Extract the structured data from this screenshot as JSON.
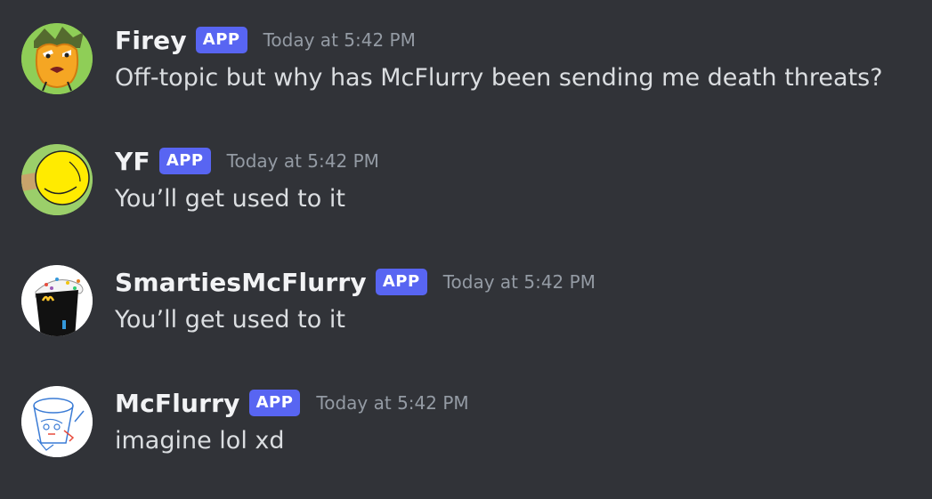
{
  "messages": [
    {
      "username": "Firey",
      "badge": "APP",
      "timestamp": "Today at 5:42 PM",
      "content": "Off-topic but why has McFlurry been sending me death threats?",
      "avatar_icon": "firey-avatar"
    },
    {
      "username": "YF",
      "badge": "APP",
      "timestamp": "Today at 5:42 PM",
      "content": "You’ll get used to it",
      "avatar_icon": "yf-avatar"
    },
    {
      "username": "SmartiesMcFlurry",
      "badge": "APP",
      "timestamp": "Today at 5:42 PM",
      "content": "You’ll get used to it",
      "avatar_icon": "smarties-mcflurry-avatar"
    },
    {
      "username": "McFlurry",
      "badge": "APP",
      "timestamp": "Today at 5:42 PM",
      "content": "imagine lol xd",
      "avatar_icon": "mcflurry-avatar"
    }
  ],
  "colors": {
    "background": "#313338",
    "username": "#f2f3f5",
    "badge": "#5865f2",
    "timestamp": "#949ba4",
    "text": "#dbdee1"
  }
}
